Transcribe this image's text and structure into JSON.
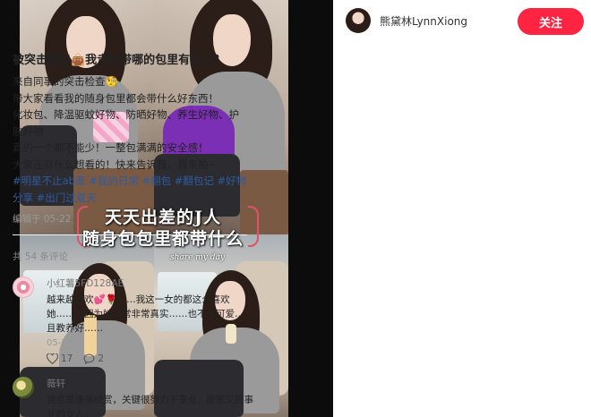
{
  "collage": {
    "overlay_line1": "天天出差的J人",
    "overlay_line2": "随身包包里都带什么",
    "overlay_sub": "share my day"
  },
  "post": {
    "author": "熊黛林LynnXiong",
    "follow_label": "关注",
    "title": "被突击翻包👜我走哪带哪的包里有什么？",
    "body": [
      "来自同事的突击检查🧐",
      "带大家看看我的随身包里都会带什么好东西！",
      "化妆包、降温驱蚊好物、防晒好物、养生好物、护肤好物",
      "真的一个都不能少！一整包满满的安全感！",
      "大家还有什么想看的！快来告诉我，我来拍~"
    ],
    "tags": [
      "#明星不止ab面",
      "#我的日常",
      "#翻包",
      "#翻包记",
      "#好物分享",
      "#出门过夏天"
    ],
    "edit_date": "编辑于 05-22",
    "comment_count": "共 54 条评论"
  },
  "comments": [
    {
      "user": "小红薯5FD128AE",
      "text": "越来越喜欢💕🌹……我这一女的都这么喜欢她……就因为她非常非常真实……也不装可爱……且教养好……",
      "date": "05-22",
      "likes": "17",
      "replies": "2"
    },
    {
      "user": "薇轩",
      "text": "我也是逐渐欣赏，关键很努力干事业，顾家又顾事业的女人。"
    }
  ],
  "icons": [
    "heart-icon",
    "comment-icon"
  ],
  "colors": {
    "accent": "#ff2442",
    "tag": "#2f5a9e"
  }
}
